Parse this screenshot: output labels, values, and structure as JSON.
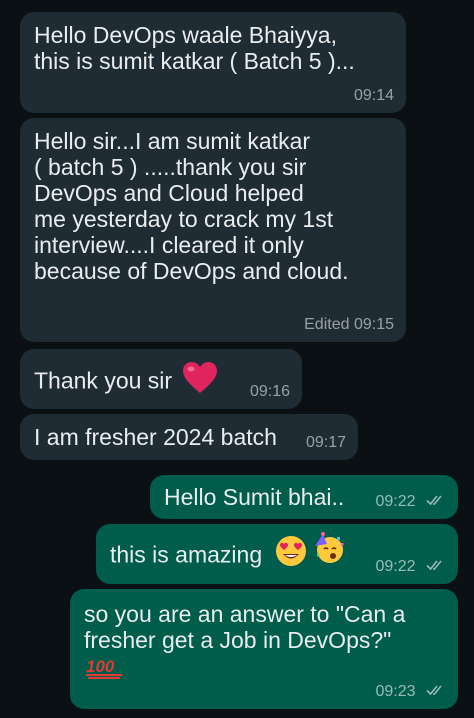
{
  "chat": {
    "messages": [
      {
        "direction": "incoming",
        "text": "Hello DevOps waale Bhaiyya,\nthis is sumit katkar ( Batch 5 )...",
        "time": "09:14"
      },
      {
        "direction": "incoming",
        "text": "Hello sir...I am sumit katkar\n( batch 5 ) .....thank you sir\nDevOps and Cloud helped\nme yesterday to crack my 1st\ninterview....I cleared it only\nbecause of DevOps and cloud.",
        "edited_label": "Edited",
        "time": "09:15"
      },
      {
        "direction": "incoming",
        "text": "Thank you sir",
        "emoji": "red-heart",
        "time": "09:16"
      },
      {
        "direction": "incoming",
        "text": "I am fresher 2024 batch",
        "time": "09:17"
      },
      {
        "direction": "outgoing",
        "text": "Hello Sumit bhai..",
        "time": "09:22",
        "status": "read"
      },
      {
        "direction": "outgoing",
        "text": "this is amazing",
        "emoji": [
          "heart-eyes-face",
          "partying-face"
        ],
        "time": "09:22",
        "status": "read"
      },
      {
        "direction": "outgoing",
        "text": "so you are an answer to \"Can a\nfresher get a Job in DevOps?\"",
        "emoji": "hundred-points",
        "emoji_text": "100",
        "time": "09:23",
        "status": "read"
      }
    ]
  },
  "colors": {
    "background": "#0b1014",
    "incoming_bubble": "#1f2c34",
    "outgoing_bubble": "#005c4b",
    "text": "#e9edef",
    "heart": "#e0245e",
    "hundred": "#e53935"
  }
}
